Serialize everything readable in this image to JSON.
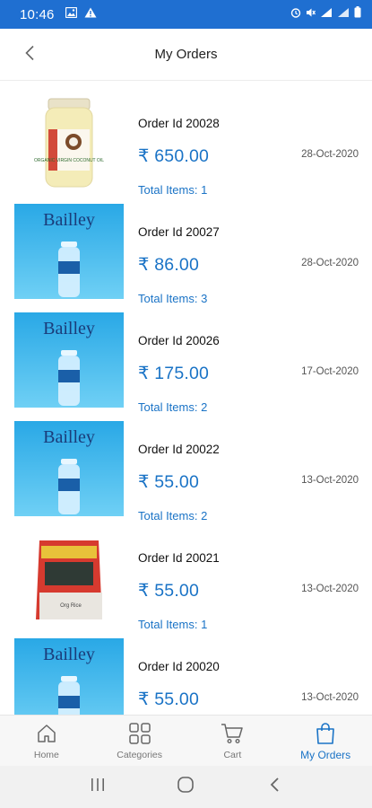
{
  "status_bar": {
    "time": "10:46",
    "left_icons": [
      "image-icon",
      "alert-icon"
    ],
    "right_icons": [
      "alarm-icon",
      "mute-icon",
      "signal-icon",
      "signal-icon",
      "battery-icon"
    ],
    "background": "#1f6fd1"
  },
  "header": {
    "title": "My Orders",
    "back_icon": "chevron-left-icon"
  },
  "colors": {
    "accent": "#1a73c6",
    "text": "#111111",
    "muted": "#555555"
  },
  "orders": [
    {
      "id_label": "Order Id 20028",
      "amount": "₹ 650.00",
      "date": "28-Oct-2020",
      "items": "Total Items: 1",
      "image": "coconut-oil-jar"
    },
    {
      "id_label": "Order Id 20027",
      "amount": "₹ 86.00",
      "date": "28-Oct-2020",
      "items": "Total Items: 3",
      "image": "bailley-water"
    },
    {
      "id_label": "Order Id 20026",
      "amount": "₹ 175.00",
      "date": "17-Oct-2020",
      "items": "Total Items: 2",
      "image": "bailley-water"
    },
    {
      "id_label": "Order Id 20022",
      "amount": "₹ 55.00",
      "date": "13-Oct-2020",
      "items": "Total Items: 2",
      "image": "bailley-water"
    },
    {
      "id_label": "Order Id 20021",
      "amount": "₹ 55.00",
      "date": "13-Oct-2020",
      "items": "Total Items: 1",
      "image": "rice-packet"
    },
    {
      "id_label": "Order Id 20020",
      "amount": "₹ 55.00",
      "date": "13-Oct-2020",
      "items": "",
      "image": "bailley-water"
    }
  ],
  "product_text": {
    "bailley": "Bailley",
    "oil_label": "ORGANIC VIRGIN COCONUT OIL",
    "rice_label": "Org Rice"
  },
  "bottom_nav": [
    {
      "label": "Home",
      "icon": "home-icon",
      "active": false
    },
    {
      "label": "Categories",
      "icon": "categories-icon",
      "active": false
    },
    {
      "label": "Cart",
      "icon": "cart-icon",
      "active": false
    },
    {
      "label": "My Orders",
      "icon": "shopping-bag-icon",
      "active": true
    }
  ],
  "system_nav": [
    "recent-apps-icon",
    "home-circle-icon",
    "back-icon"
  ]
}
